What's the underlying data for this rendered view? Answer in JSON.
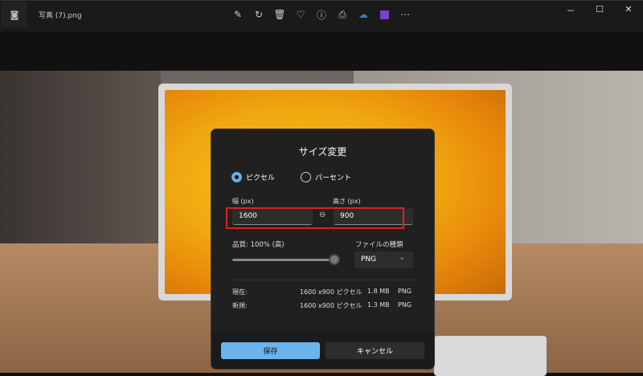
{
  "titlebar": {
    "filename": "写真 (7).png",
    "app_icon": "photos-icon",
    "tools": [
      "edit-icon",
      "rotate-icon",
      "delete-icon",
      "heart-icon",
      "info-icon",
      "print-icon",
      "onedrive-icon",
      "clipchamp-icon",
      "more-icon"
    ],
    "window": [
      "－",
      "☐",
      "✕"
    ]
  },
  "dialog": {
    "title": "サイズ変更",
    "radio_pixel": "ピクセル",
    "radio_percent": "パーセント",
    "width_label": "幅 (px)",
    "height_label": "高さ (px)",
    "width_value": "1600",
    "height_value": "900",
    "quality_label": "品質: 100% (高)",
    "quality_value": 100,
    "filetype_label": "ファイルの種類",
    "filetype_value": "PNG",
    "current": {
      "label": "現在:",
      "dims": "1600 x900 ピクセル",
      "size": "1.8 MB",
      "format": "PNG"
    },
    "new": {
      "label": "新規:",
      "dims": "1600 x900 ピクセル",
      "size": "1.3 MB",
      "format": "PNG"
    },
    "save": "保存",
    "cancel": "キャンセル"
  },
  "colors": {
    "accent": "#6bb3ea",
    "highlight": "#e02020"
  }
}
